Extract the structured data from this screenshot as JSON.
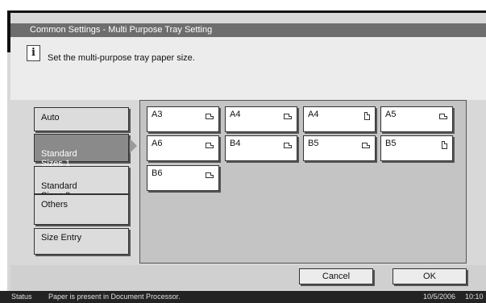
{
  "title": "Common Settings - Multi Purpose Tray Setting",
  "info": {
    "icon": "info-icon",
    "message": "Set the multi-purpose tray paper size."
  },
  "side_menu": [
    {
      "label": "Auto",
      "selected": false
    },
    {
      "label": "Standard\nSizes 1",
      "selected": true
    },
    {
      "label": "Standard\nSizes 2",
      "selected": false
    },
    {
      "label": "Others",
      "selected": false
    },
    {
      "label": "Size Entry",
      "selected": false
    }
  ],
  "sizes": [
    {
      "label": "A3",
      "orientation": "landscape"
    },
    {
      "label": "A4",
      "orientation": "landscape"
    },
    {
      "label": "A4",
      "orientation": "portrait"
    },
    {
      "label": "A5",
      "orientation": "landscape"
    },
    {
      "label": "A6",
      "orientation": "landscape"
    },
    {
      "label": "B4",
      "orientation": "landscape"
    },
    {
      "label": "B5",
      "orientation": "landscape"
    },
    {
      "label": "B5",
      "orientation": "portrait"
    },
    {
      "label": "B6",
      "orientation": "landscape"
    }
  ],
  "buttons": {
    "cancel": "Cancel",
    "ok": "OK"
  },
  "status": {
    "label": "Status",
    "message": "Paper is present in Document Processor.",
    "date": "10/5/2006",
    "time": "10:10"
  }
}
